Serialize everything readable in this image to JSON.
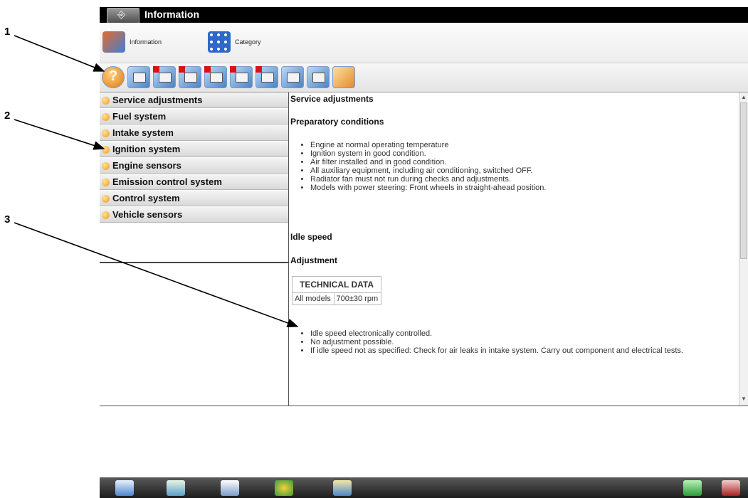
{
  "callouts": [
    "1",
    "2",
    "3"
  ],
  "window": {
    "title": "Information"
  },
  "modes": [
    {
      "label": "Information",
      "icon": "information-mode-icon"
    },
    {
      "label": "Category",
      "icon": "category-grid-icon"
    }
  ],
  "toolbar": {
    "icons": [
      "help-icon",
      "vehicle-info-icon",
      "document-icon",
      "document-icon",
      "document-icon",
      "tools-icon",
      "document-icon",
      "print-icon",
      "document-icon",
      "notes-icon"
    ]
  },
  "nav": {
    "items": [
      "Service adjustments",
      "Fuel system",
      "Intake system",
      "Ignition system",
      "Engine sensors",
      "Emission control system",
      "Control system",
      "Vehicle sensors"
    ]
  },
  "content": {
    "heading": "Service adjustments",
    "prep_heading": "Preparatory conditions",
    "prep_items": [
      "Engine at normal operating temperature",
      "Ignition system in good condition.",
      "Air filter installed and in good condition.",
      "All auxiliary equipment, including air conditioning, switched OFF.",
      "Radiator fan must not run during checks and adjustments.",
      "Models with power steering: Front wheels in straight-ahead position."
    ],
    "idle_heading": "Idle speed",
    "adjust_heading": "Adjustment",
    "tech_table": {
      "header": "TECHNICAL DATA",
      "rows": [
        [
          "All models",
          "700±30 rpm"
        ]
      ]
    },
    "notes": [
      "Idle speed electronically controlled.",
      "No adjustment possible.",
      "If idle speed not as specified: Check for air leaks in intake system. Carry out component and electrical tests."
    ]
  },
  "taskbar": {
    "icons": [
      "home-icon",
      "list-icon",
      "data-icon",
      "vehicle-icon",
      "scanner-icon",
      "battery-icon",
      "exit-icon"
    ]
  },
  "colors": {
    "titlebar": "#000000",
    "nav_bullet": "#f09a18",
    "arrow": "#000000"
  }
}
